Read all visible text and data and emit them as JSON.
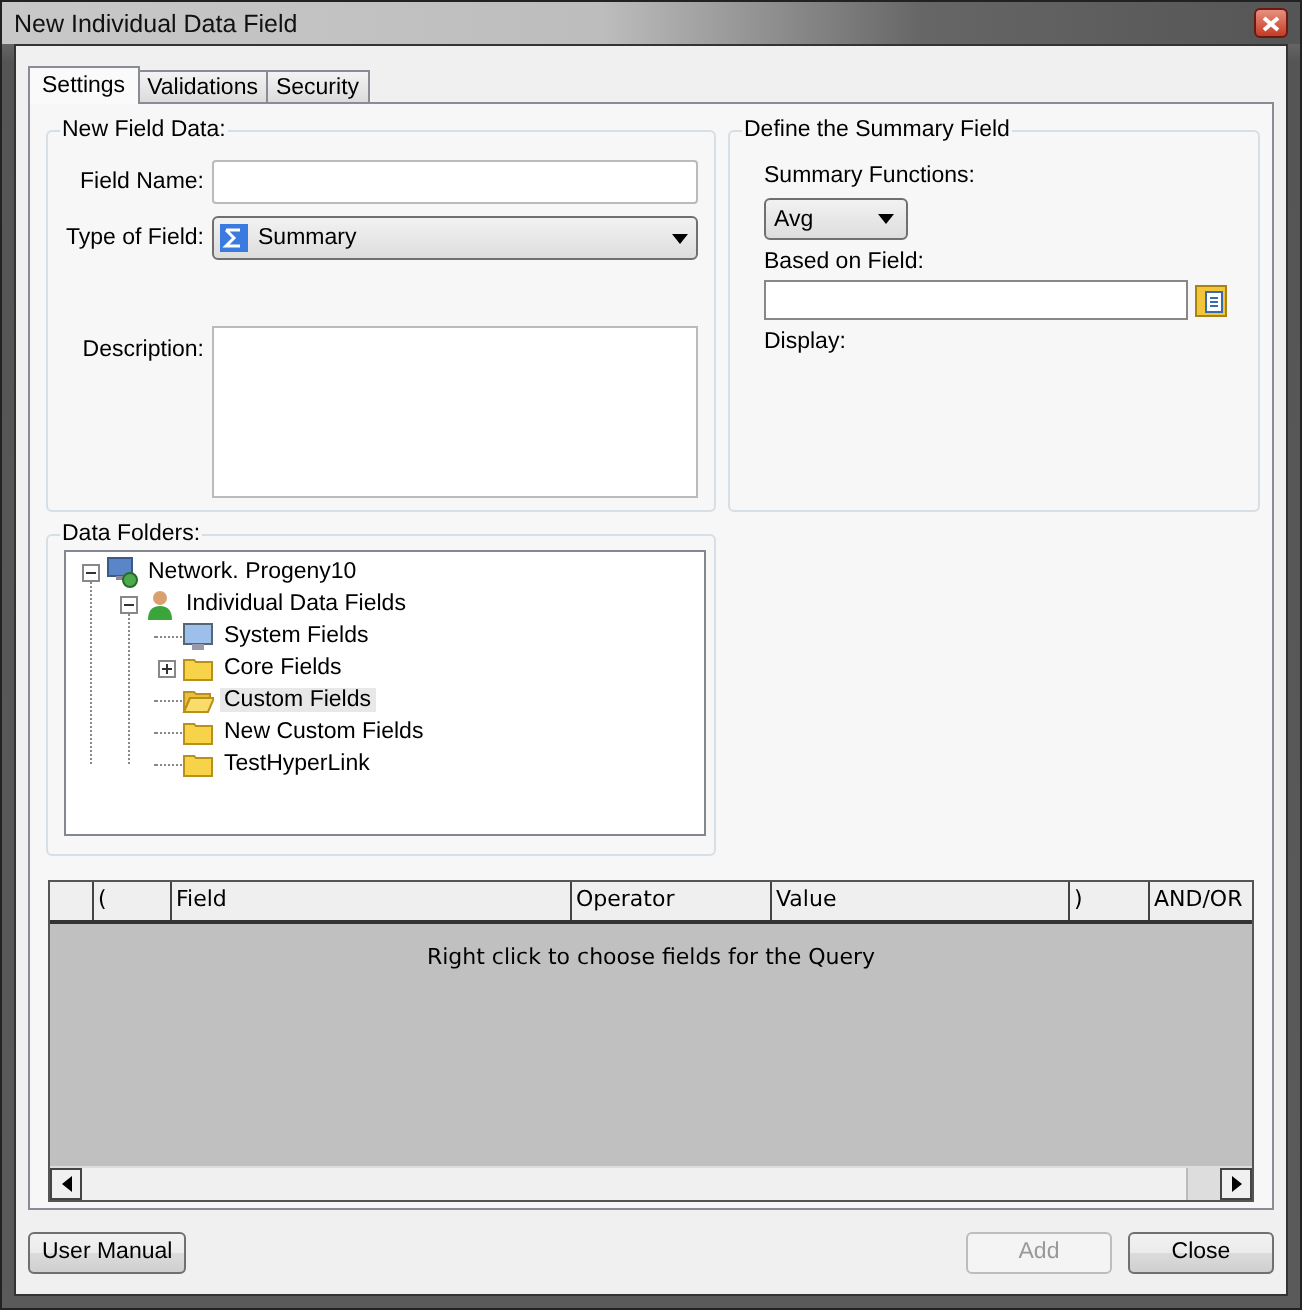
{
  "window": {
    "title": "New Individual Data Field"
  },
  "tabs": [
    {
      "label": "Settings",
      "selected": true
    },
    {
      "label": "Validations",
      "selected": false
    },
    {
      "label": "Security",
      "selected": false
    }
  ],
  "new_field_data": {
    "title": "New Field Data:",
    "field_name": {
      "label": "Field Name:"
    },
    "type_of_field": {
      "label": "Type of Field:",
      "value": "Summary"
    },
    "description": {
      "label": "Description:"
    }
  },
  "summary": {
    "title": "Define the Summary Field",
    "functions_label": "Summary Functions:",
    "function_value": "Avg",
    "based_on_label": "Based on Field:",
    "display_label": "Display:"
  },
  "data_folders": {
    "title": "Data Folders:",
    "tree": [
      {
        "label": "Network. Progeny10",
        "kind": "network",
        "expanded": true,
        "selected": false,
        "children": [
          {
            "label": "Individual Data Fields",
            "kind": "person",
            "expanded": true,
            "selected": false,
            "children": [
              {
                "label": "System Fields",
                "kind": "monitor",
                "selected": false
              },
              {
                "label": "Core Fields",
                "kind": "folder",
                "expanded": false,
                "selected": false
              },
              {
                "label": "Custom Fields",
                "kind": "open",
                "selected": true
              },
              {
                "label": "New Custom Fields",
                "kind": "folder",
                "selected": false
              },
              {
                "label": "TestHyperLink",
                "kind": "folder",
                "selected": false
              }
            ]
          }
        ]
      }
    ]
  },
  "query_grid": {
    "columns": [
      "(",
      "Field",
      "Operator",
      "Value",
      ")",
      "AND/OR"
    ],
    "empty_message": "Right click to choose fields for the Query"
  },
  "buttons": [
    {
      "label": "User Manual",
      "disabled": false
    },
    {
      "label": "Add",
      "disabled": true
    },
    {
      "label": "Close",
      "disabled": false
    }
  ]
}
